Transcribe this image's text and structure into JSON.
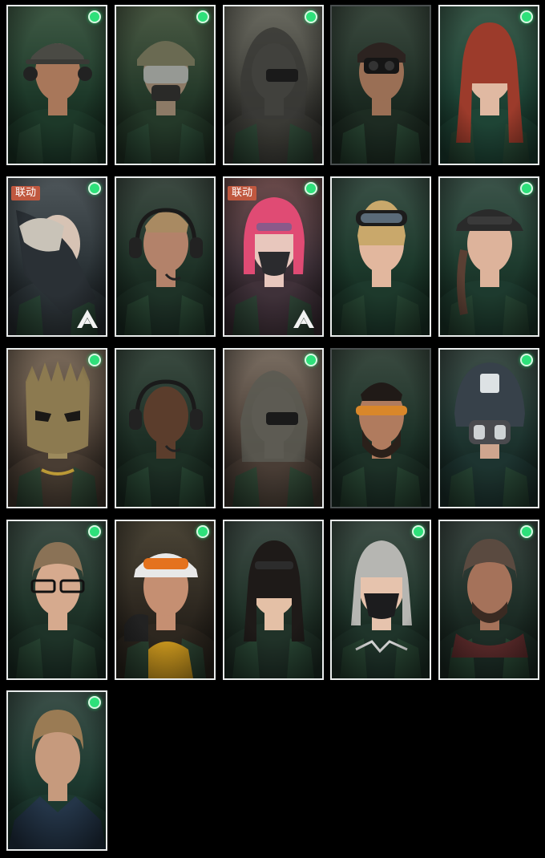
{
  "grid": {
    "collab_badge_text": "联动",
    "status_color": "#2ee07a",
    "operators": [
      {
        "status_dot": true,
        "collab": false,
        "palette": [
          "#3f5a45",
          "#1e3a2a",
          "#0f1e15"
        ],
        "skin": "#a8775a",
        "hair": "#2b2622",
        "headgear": "cap-headset",
        "icon": "soldier-cap-headset-portrait"
      },
      {
        "status_dot": true,
        "collab": false,
        "palette": [
          "#4a5a44",
          "#253a2a",
          "#121c14"
        ],
        "skin": "#8c7a66",
        "hair": "#5d5a44",
        "headgear": "helmet-visor",
        "icon": "soldier-helmet-visor-portrait"
      },
      {
        "status_dot": true,
        "collab": false,
        "palette": [
          "#6a6a60",
          "#3b3b36",
          "#1d1c1a"
        ],
        "skin": "#6d6d68",
        "hair": "#3a3a36",
        "headgear": "ghillie-nvg",
        "icon": "ghillie-nvg-portrait"
      },
      {
        "status_dot": false,
        "collab": false,
        "palette": [
          "#3b4a3f",
          "#1d2c23",
          "#0c140f"
        ],
        "skin": "#9a6f55",
        "hair": "#2c2320",
        "headgear": "nvg",
        "icon": "soldier-nvg-portrait"
      },
      {
        "status_dot": true,
        "collab": false,
        "palette": [
          "#3a5a4a",
          "#1f4436",
          "#0f2a20"
        ],
        "skin": "#e0b9a2",
        "hair": "#9c3b2b",
        "headgear": "long-hair",
        "icon": "red-hair-woman-portrait"
      },
      {
        "status_dot": true,
        "collab": true,
        "palette": [
          "#4e565a",
          "#2c3438",
          "#15191c"
        ],
        "skin": "#d7c3b4",
        "hair": "#c9c3b8",
        "headgear": "leaning",
        "icon": "collab-leaning-figure-portrait"
      },
      {
        "status_dot": false,
        "collab": false,
        "palette": [
          "#3d4a42",
          "#1f3328",
          "#0e1a13"
        ],
        "skin": "#b3826a",
        "hair": "#a98a62",
        "headgear": "headset",
        "icon": "blond-soldier-headset-portrait"
      },
      {
        "status_dot": true,
        "collab": true,
        "palette": [
          "#6a4a4a",
          "#40323a",
          "#231a1e"
        ],
        "skin": "#e8c7bd",
        "hair": "#e04b74",
        "headgear": "mask-pink-hair",
        "icon": "collab-pink-hair-masked-portrait"
      },
      {
        "status_dot": false,
        "collab": false,
        "palette": [
          "#3a5046",
          "#1d3a2c",
          "#0e1f17"
        ],
        "skin": "#e2b79e",
        "hair": "#c9a86b",
        "headgear": "goggles",
        "icon": "blonde-woman-goggles-portrait"
      },
      {
        "status_dot": true,
        "collab": false,
        "palette": [
          "#3c544a",
          "#1e3b2e",
          "#0f2119"
        ],
        "skin": "#ddb39b",
        "hair": "#5a3f33",
        "headgear": "cap-glasses",
        "icon": "woman-cap-braid-portrait"
      },
      {
        "status_dot": true,
        "collab": false,
        "palette": [
          "#7a6a5a",
          "#4a3e34",
          "#231d19"
        ],
        "skin": "#9c8a5c",
        "hair": "#2a2420",
        "headgear": "gold-mask",
        "icon": "gold-spiked-mask-portrait"
      },
      {
        "status_dot": false,
        "collab": false,
        "palette": [
          "#3a4a40",
          "#1e3026",
          "#0e1912"
        ],
        "skin": "#5b3d2c",
        "hair": "#1a1614",
        "headgear": "headset-bald",
        "icon": "bald-bearded-headset-portrait"
      },
      {
        "status_dot": true,
        "collab": false,
        "palette": [
          "#7a6e62",
          "#4a3e36",
          "#2a2420"
        ],
        "skin": "#6a6058",
        "hair": "#5a5a52",
        "headgear": "ghillie",
        "icon": "ghillie-hood-portrait"
      },
      {
        "status_dot": false,
        "collab": false,
        "palette": [
          "#3a4a40",
          "#1d3228",
          "#0d1813"
        ],
        "skin": "#b07b5e",
        "hair": "#201a17",
        "headgear": "shades",
        "icon": "bearded-orange-shades-portrait"
      },
      {
        "status_dot": true,
        "collab": false,
        "palette": [
          "#3c4c46",
          "#1e3530",
          "#0f1c18"
        ],
        "skin": "#cfa58e",
        "hair": "#3a3a3a",
        "headgear": "helmet-mask",
        "icon": "helmet-respirator-portrait"
      },
      {
        "status_dot": true,
        "collab": false,
        "palette": [
          "#3c4c44",
          "#1f3429",
          "#0f1a14"
        ],
        "skin": "#d6aa8e",
        "hair": "#8a7256",
        "headgear": "glasses",
        "icon": "glasses-soldier-portrait"
      },
      {
        "status_dot": true,
        "collab": false,
        "palette": [
          "#4a4436",
          "#2e2820",
          "#15130f"
        ],
        "skin": "#c58f72",
        "hair": "#2a2522",
        "headgear": "visor-goggles",
        "icon": "woman-visor-goggles-portrait"
      },
      {
        "status_dot": false,
        "collab": false,
        "palette": [
          "#3d4a44",
          "#213329",
          "#0f1a14"
        ],
        "skin": "#e4c0a6",
        "hair": "#1e1a18",
        "headgear": "long-dark-hair",
        "icon": "dark-hair-woman-portrait"
      },
      {
        "status_dot": true,
        "collab": false,
        "palette": [
          "#3e4e46",
          "#20352b",
          "#0f1b15"
        ],
        "skin": "#e6c3ad",
        "hair": "#b6b6b2",
        "headgear": "mask-braids",
        "icon": "silver-braids-masked-portrait"
      },
      {
        "status_dot": true,
        "collab": false,
        "palette": [
          "#3a4641",
          "#1e2e27",
          "#0e1713"
        ],
        "skin": "#a5725a",
        "hair": "#5a4a40",
        "headgear": "scarf",
        "icon": "veteran-scarf-portrait"
      },
      {
        "status_dot": true,
        "collab": false,
        "palette": [
          "#3b4f48",
          "#1e3a30",
          "#0e1e18"
        ],
        "skin": "#c69a7d",
        "hair": "#9a7b54",
        "headgear": "jacket",
        "icon": "blond-man-jacket-portrait"
      }
    ]
  }
}
